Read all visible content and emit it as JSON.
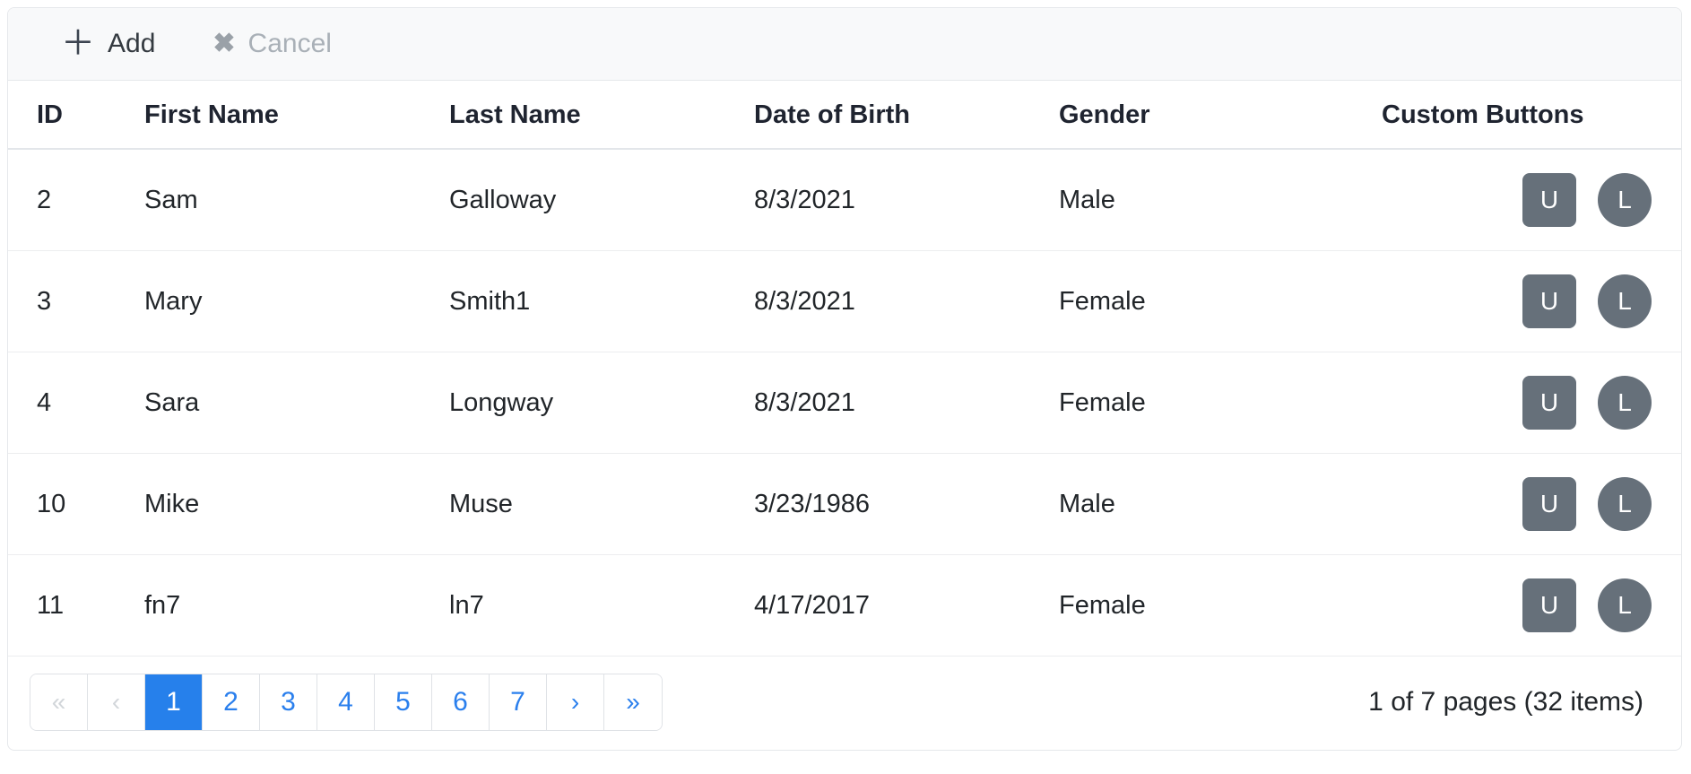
{
  "toolbar": {
    "add": {
      "label": "Add",
      "icon": "plus-icon",
      "glyph": "＋",
      "enabled": true
    },
    "cancel": {
      "label": "Cancel",
      "icon": "close-icon",
      "glyph": "✖",
      "enabled": false
    }
  },
  "table": {
    "columns": [
      "ID",
      "First Name",
      "Last Name",
      "Date of Birth",
      "Gender",
      "Custom Buttons"
    ],
    "rows": [
      {
        "id": "2",
        "first": "Sam",
        "last": "Galloway",
        "dob": "8/3/2021",
        "gender": "Male"
      },
      {
        "id": "3",
        "first": "Mary",
        "last": "Smith1",
        "dob": "8/3/2021",
        "gender": "Female"
      },
      {
        "id": "4",
        "first": "Sara",
        "last": "Longway",
        "dob": "8/3/2021",
        "gender": "Female"
      },
      {
        "id": "10",
        "first": "Mike",
        "last": "Muse",
        "dob": "3/23/1986",
        "gender": "Male"
      },
      {
        "id": "11",
        "first": "fn7",
        "last": "ln7",
        "dob": "4/17/2017",
        "gender": "Female"
      }
    ],
    "row_buttons": [
      {
        "label": "U",
        "shape": "square",
        "name": "row-button-u"
      },
      {
        "label": "L",
        "shape": "circle",
        "name": "row-button-l"
      }
    ]
  },
  "pager": {
    "items": [
      {
        "label": "«",
        "name": "pagination-first",
        "state": "disabled",
        "nav": true
      },
      {
        "label": "‹",
        "name": "pagination-prev",
        "state": "disabled",
        "nav": true
      },
      {
        "label": "1",
        "name": "pagination-page-1",
        "state": "active"
      },
      {
        "label": "2",
        "name": "pagination-page-2",
        "state": "link"
      },
      {
        "label": "3",
        "name": "pagination-page-3",
        "state": "link"
      },
      {
        "label": "4",
        "name": "pagination-page-4",
        "state": "link"
      },
      {
        "label": "5",
        "name": "pagination-page-5",
        "state": "link"
      },
      {
        "label": "6",
        "name": "pagination-page-6",
        "state": "link"
      },
      {
        "label": "7",
        "name": "pagination-page-7",
        "state": "link"
      },
      {
        "label": "›",
        "name": "pagination-next",
        "state": "link",
        "nav": true
      },
      {
        "label": "»",
        "name": "pagination-last",
        "state": "link",
        "nav": true
      }
    ],
    "info": "1 of 7 pages (32 items)",
    "current_page": 1,
    "total_pages": 7,
    "total_items": 32
  },
  "colors": {
    "accent": "#2680eb",
    "link": "#2a7fed",
    "button_gray": "#66707a",
    "toolbar_bg": "#f8f9fa",
    "border": "#e6e8eb",
    "disabled_text": "#a9b0b7"
  }
}
